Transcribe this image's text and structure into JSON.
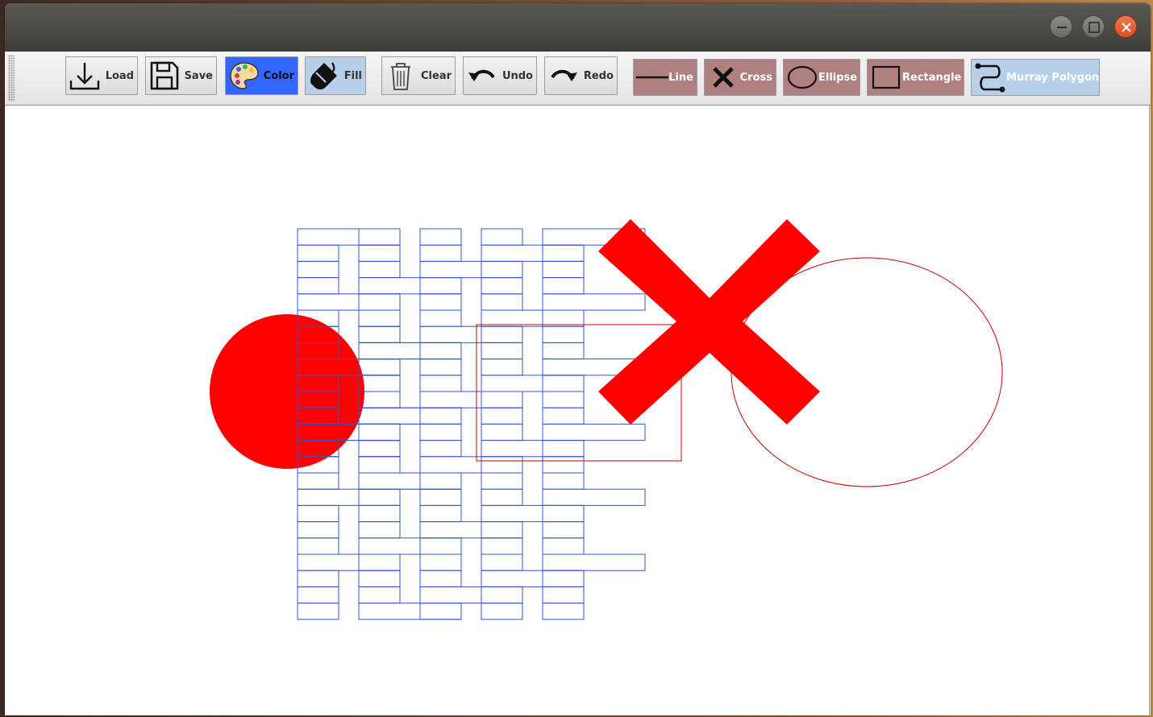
{
  "window": {
    "title": ""
  },
  "toolbar": {
    "load_label": "Load",
    "save_label": "Save",
    "color_label": "Color",
    "fill_label": "Fill",
    "clear_label": "Clear",
    "undo_label": "Undo",
    "redo_label": "Redo",
    "shapes": {
      "line_label": "Line",
      "cross_label": "Cross",
      "ellipse_label": "Ellipse",
      "rectangle_label": "Rectangle",
      "murray_label": "Murray Polygon"
    },
    "active_color": "#3366ff",
    "shape_button_color": "#b07f80",
    "selected_tool_color": "#b8cfe8"
  },
  "canvas": {
    "stroke_color": "#cc0000",
    "fill_color": "#ff0000",
    "polygon_color": "#3355cc"
  }
}
